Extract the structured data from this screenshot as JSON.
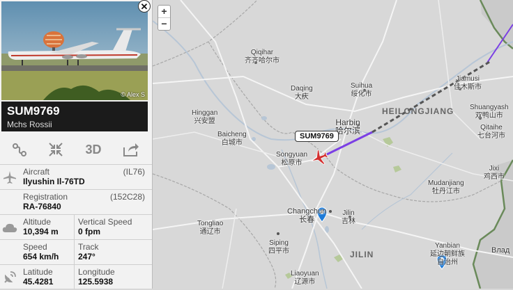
{
  "photo": {
    "credit": "© Alex S"
  },
  "flight": {
    "callsign": "SUM9769",
    "airline": "Mchs Rossii"
  },
  "actions": [
    "route-icon",
    "fit-icon",
    "3D",
    "share-icon"
  ],
  "details": {
    "aircraft_label": "Aircraft",
    "aircraft_code": "(IL76)",
    "aircraft_value": "Ilyushin Il-76TD",
    "registration_label": "Registration",
    "registration_code": "(152C28)",
    "registration_value": "RA-76840",
    "altitude_label": "Altitude",
    "altitude_value": "10,394 m",
    "vspeed_label": "Vertical Speed",
    "vspeed_value": "0 fpm",
    "speed_label": "Speed",
    "speed_value": "654 km/h",
    "track_label": "Track",
    "track_value": "247°",
    "lat_label": "Latitude",
    "lat_value": "45.4281",
    "lon_label": "Longitude",
    "lon_value": "125.5938"
  },
  "map": {
    "zoom_in": "+",
    "zoom_out": "−",
    "flight_tag": "SUM9769",
    "regions": {
      "heilongjiang": "HEILONGJIANG",
      "jilin": "JILIN"
    },
    "cities": {
      "qiqihar": "Qiqihar",
      "qiqihar_cn": "齐齐哈尔市",
      "suihua": "Suihua",
      "suihua_cn": "绥化市",
      "daqing": "Daqing",
      "daqing_cn": "大庆",
      "jiamusi": "Jiamusi",
      "jiamusi_cn": "佳木斯市",
      "hinggan": "Hinggan",
      "hinggan_cn": "兴安盟",
      "harbin": "Harbin",
      "harbin_cn": "哈尔滨",
      "shuangyashan": "Shuangyash",
      "shuangyashan_cn": "双鸭山市",
      "baicheng": "Baicheng",
      "baicheng_cn": "白城市",
      "qitaihe": "Qitaihe",
      "qitaihe_cn": "七台河市",
      "songyuan": "Songyuan",
      "songyuan_cn": "松原市",
      "jixi": "Jixi",
      "jixi_cn": "鸡西市",
      "mudanjiang": "Mudanjiang",
      "mudanjiang_cn": "牡丹江市",
      "changchun": "Changchun",
      "changchun_cn": "长春",
      "jilin": "Jilin",
      "jilin_cn": "吉林",
      "tongliao": "Tongliao",
      "tongliao_cn": "通辽市",
      "siping": "Siping",
      "siping_cn": "四平市",
      "yanbian": "Yanbian",
      "yanbian_cn": "延边朝鲜族自治州",
      "liaoyuan": "Liaoyuan",
      "liaoyuan_cn": "辽源市",
      "vlad": "Влад"
    }
  },
  "colors": {
    "trail_flown": "#7b3fe4",
    "trail_projected": "#555555",
    "aircraft": "#d32f2f",
    "marker": "#1e7bd8",
    "header_bg": "#1b1b1b"
  }
}
